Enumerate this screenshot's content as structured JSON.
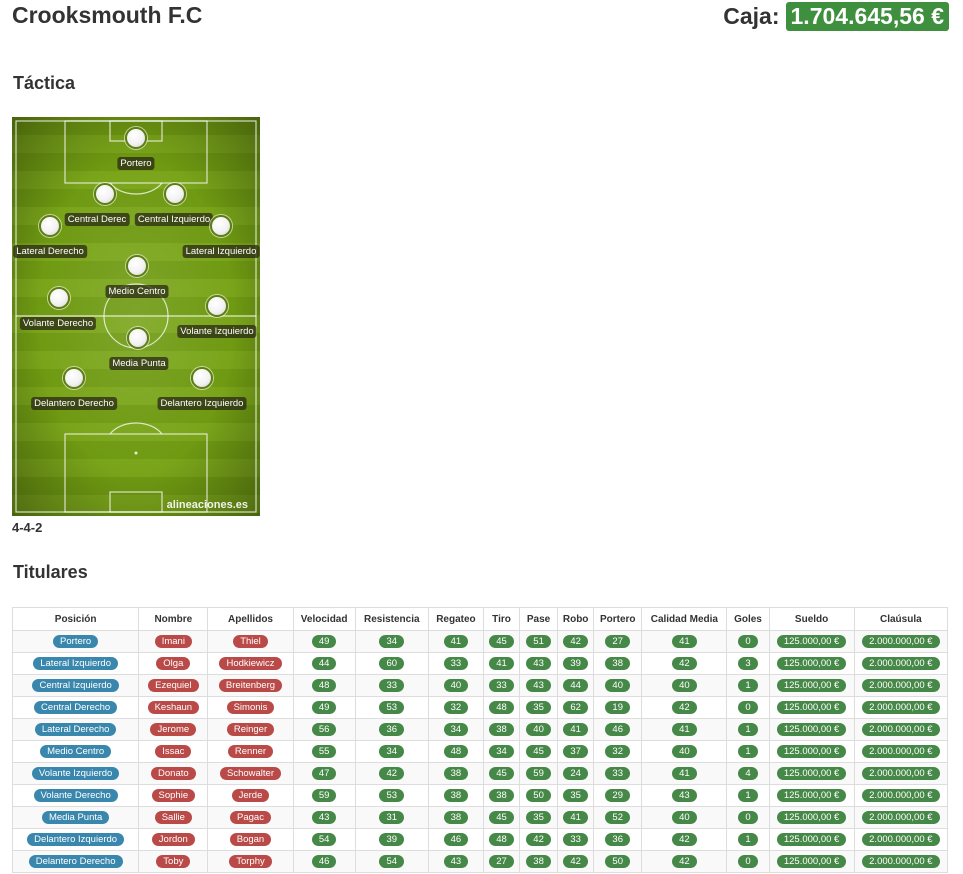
{
  "header": {
    "club_name": "Crooksmouth F.C",
    "caja_label": "Caja:",
    "caja_amount": "1.704.645,56 €"
  },
  "tactic": {
    "title": "Táctica",
    "formation": "4-4-2",
    "watermark": "alineaciones.es",
    "positions": [
      "Portero",
      "Central Derec",
      "Central Izquierdo",
      "Lateral Derecho",
      "Lateral Izquierdo",
      "Medio Centro",
      "Volante Derecho",
      "Volante Izquierdo",
      "Media Punta",
      "Delantero Derecho",
      "Delantero Izquierdo"
    ]
  },
  "starters": {
    "title": "Titulares",
    "columns": [
      "Posición",
      "Nombre",
      "Apellidos",
      "Velocidad",
      "Resistencia",
      "Regateo",
      "Tiro",
      "Pase",
      "Robo",
      "Portero",
      "Calidad Media",
      "Goles",
      "Sueldo",
      "Claúsula"
    ],
    "rows": [
      [
        "Portero",
        "Imani",
        "Thiel",
        "49",
        "34",
        "41",
        "45",
        "51",
        "42",
        "27",
        "41",
        "0",
        "125.000,00 €",
        "2.000.000,00 €"
      ],
      [
        "Lateral Izquierdo",
        "Olga",
        "Hodkiewicz",
        "44",
        "60",
        "33",
        "41",
        "43",
        "39",
        "38",
        "42",
        "3",
        "125.000,00 €",
        "2.000.000,00 €"
      ],
      [
        "Central Izquierdo",
        "Ezequiel",
        "Breitenberg",
        "48",
        "33",
        "40",
        "33",
        "43",
        "44",
        "40",
        "40",
        "1",
        "125.000,00 €",
        "2.000.000,00 €"
      ],
      [
        "Central Derecho",
        "Keshaun",
        "Simonis",
        "49",
        "53",
        "32",
        "48",
        "35",
        "62",
        "19",
        "42",
        "0",
        "125.000,00 €",
        "2.000.000,00 €"
      ],
      [
        "Lateral Derecho",
        "Jerome",
        "Reinger",
        "56",
        "36",
        "34",
        "38",
        "40",
        "41",
        "46",
        "41",
        "1",
        "125.000,00 €",
        "2.000.000,00 €"
      ],
      [
        "Medio Centro",
        "Issac",
        "Renner",
        "55",
        "34",
        "48",
        "34",
        "45",
        "37",
        "32",
        "40",
        "1",
        "125.000,00 €",
        "2.000.000,00 €"
      ],
      [
        "Volante Izquierdo",
        "Donato",
        "Schowalter",
        "47",
        "42",
        "38",
        "45",
        "59",
        "24",
        "33",
        "41",
        "4",
        "125.000,00 €",
        "2.000.000,00 €"
      ],
      [
        "Volante Derecho",
        "Sophie",
        "Jerde",
        "59",
        "53",
        "38",
        "38",
        "50",
        "35",
        "29",
        "43",
        "1",
        "125.000,00 €",
        "2.000.000,00 €"
      ],
      [
        "Media Punta",
        "Sallie",
        "Pagac",
        "43",
        "31",
        "38",
        "45",
        "35",
        "41",
        "52",
        "40",
        "0",
        "125.000,00 €",
        "2.000.000,00 €"
      ],
      [
        "Delantero Izquierdo",
        "Jordon",
        "Bogan",
        "54",
        "39",
        "46",
        "48",
        "42",
        "33",
        "36",
        "42",
        "1",
        "125.000,00 €",
        "2.000.000,00 €"
      ],
      [
        "Delantero Derecho",
        "Toby",
        "Torphy",
        "46",
        "54",
        "43",
        "27",
        "38",
        "42",
        "50",
        "42",
        "0",
        "125.000,00 €",
        "2.000.000,00 €"
      ]
    ]
  },
  "colors": {
    "success": "#468847",
    "info": "#3a87ad",
    "danger": "#b94a48"
  }
}
